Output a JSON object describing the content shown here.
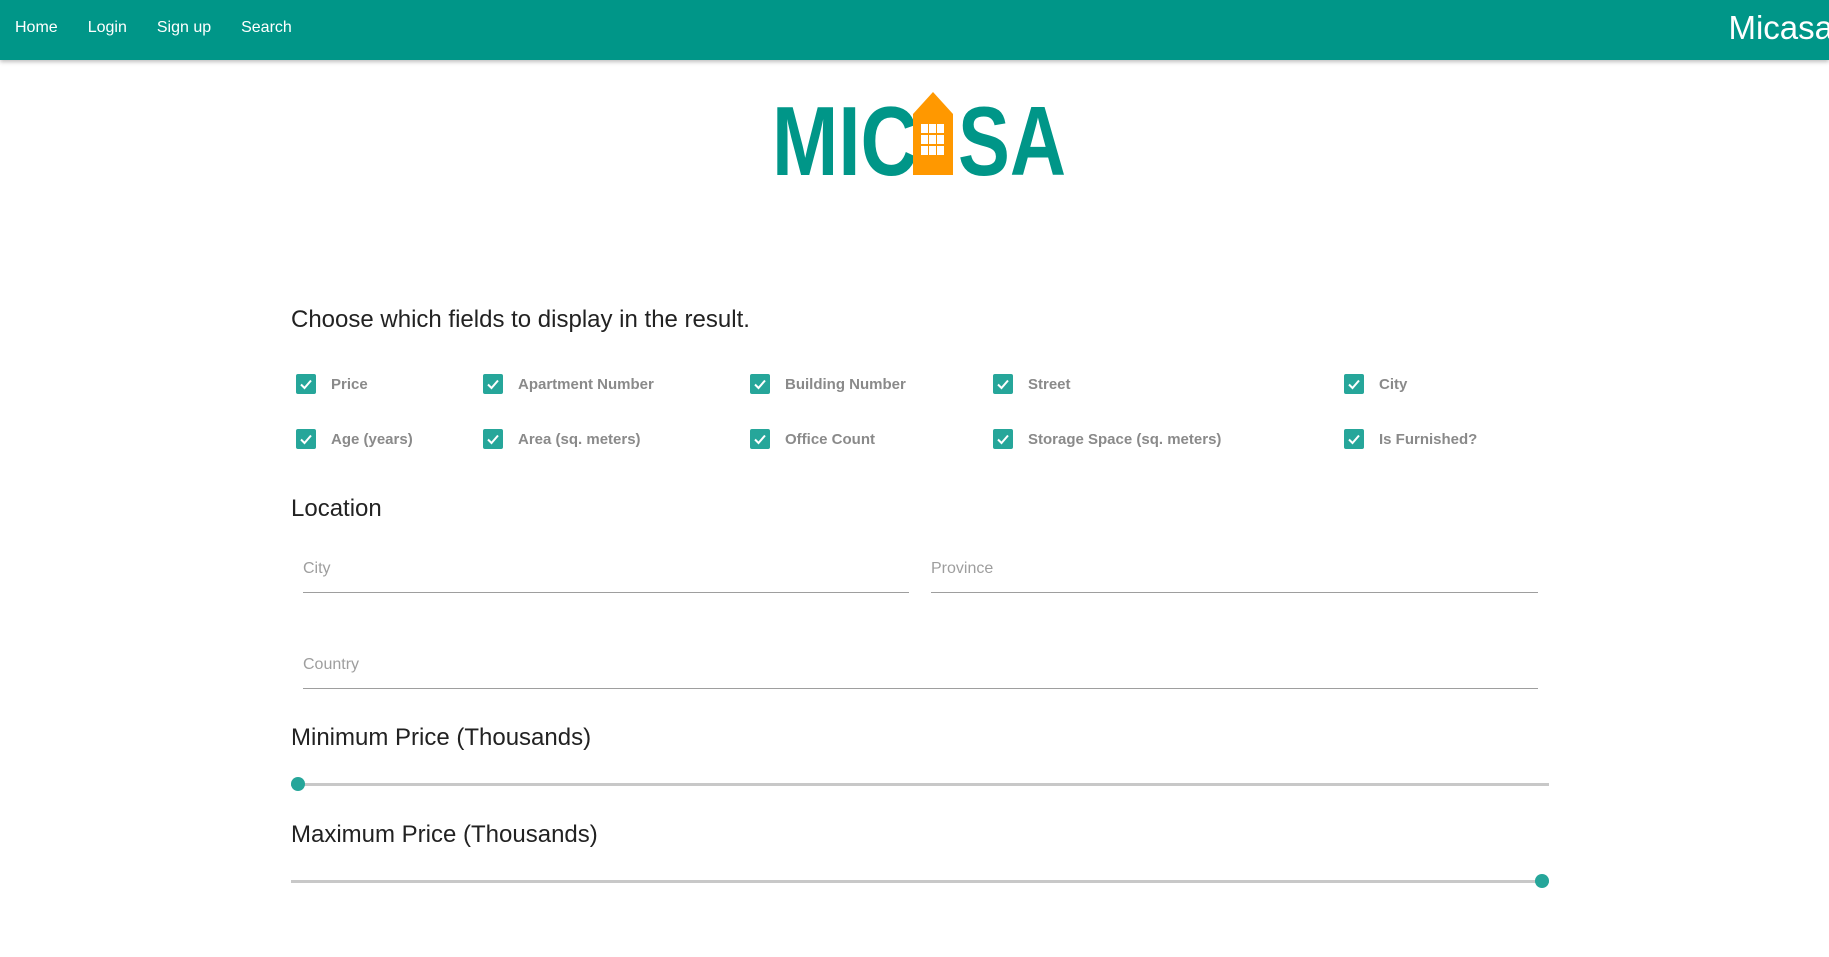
{
  "nav": {
    "links": [
      "Home",
      "Login",
      "Sign up",
      "Search"
    ],
    "brand": "Micasa"
  },
  "logo": {
    "text": "MICASA",
    "letters_left": "MIC",
    "letters_right": "SA",
    "colors": {
      "teal": "#009688",
      "orange": "#FF9800"
    }
  },
  "fields_section": {
    "heading": "Choose which fields to display in the result.",
    "checkboxes": [
      {
        "label": "Price",
        "checked": true
      },
      {
        "label": "Apartment Number",
        "checked": true
      },
      {
        "label": "Building Number",
        "checked": true
      },
      {
        "label": "Street",
        "checked": true
      },
      {
        "label": "City",
        "checked": true
      },
      {
        "label": "Age (years)",
        "checked": true
      },
      {
        "label": "Area (sq. meters)",
        "checked": true
      },
      {
        "label": "Office Count",
        "checked": true
      },
      {
        "label": "Storage Space (sq. meters)",
        "checked": true
      },
      {
        "label": "Is Furnished?",
        "checked": true
      }
    ]
  },
  "location": {
    "heading": "Location",
    "city_placeholder": "City",
    "province_placeholder": "Province",
    "country_placeholder": "Country"
  },
  "min_price": {
    "heading": "Minimum Price (Thousands)",
    "fraction": 0.0
  },
  "max_price": {
    "heading": "Maximum Price (Thousands)",
    "fraction": 1.0
  },
  "colors": {
    "accent": "#009688",
    "checkbox": "#26a69a",
    "label": "#8a8a8a"
  }
}
